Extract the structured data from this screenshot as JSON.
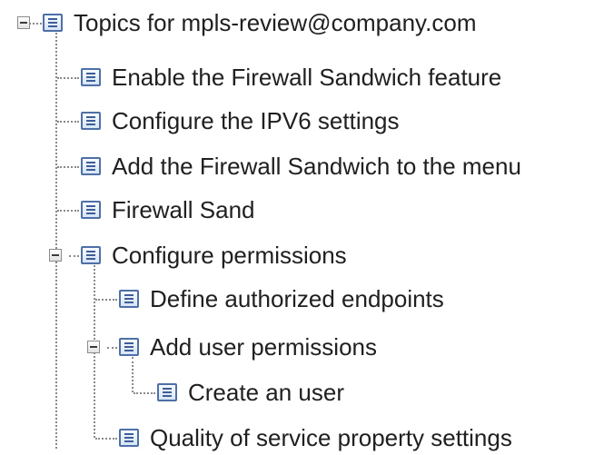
{
  "tree": {
    "root": {
      "label": "Topics for mpls-review@company.com",
      "icon": "document-icon",
      "expanded": true
    },
    "level1": [
      {
        "label": "Enable the Firewall Sandwich feature",
        "icon": "document-icon"
      },
      {
        "label": "Configure the IPV6 settings",
        "icon": "document-icon"
      },
      {
        "label": "Add the Firewall Sandwich to the menu",
        "icon": "document-icon"
      },
      {
        "label": "Firewall Sand",
        "icon": "document-icon"
      },
      {
        "label": "Configure permissions",
        "icon": "document-icon",
        "expanded": true
      }
    ],
    "level2": [
      {
        "label": "Define authorized endpoints",
        "icon": "document-icon"
      },
      {
        "label": "Add user permissions",
        "icon": "document-icon",
        "expanded": true
      },
      {
        "label": "Quality of service property settings",
        "icon": "document-icon"
      }
    ],
    "level3": [
      {
        "label": "Create an user",
        "icon": "document-icon"
      }
    ]
  },
  "colors": {
    "text": "#202020",
    "connector": "#8a8a8a",
    "icon_border": "#4f6fa8",
    "icon_fill": "#d7e5f5"
  }
}
